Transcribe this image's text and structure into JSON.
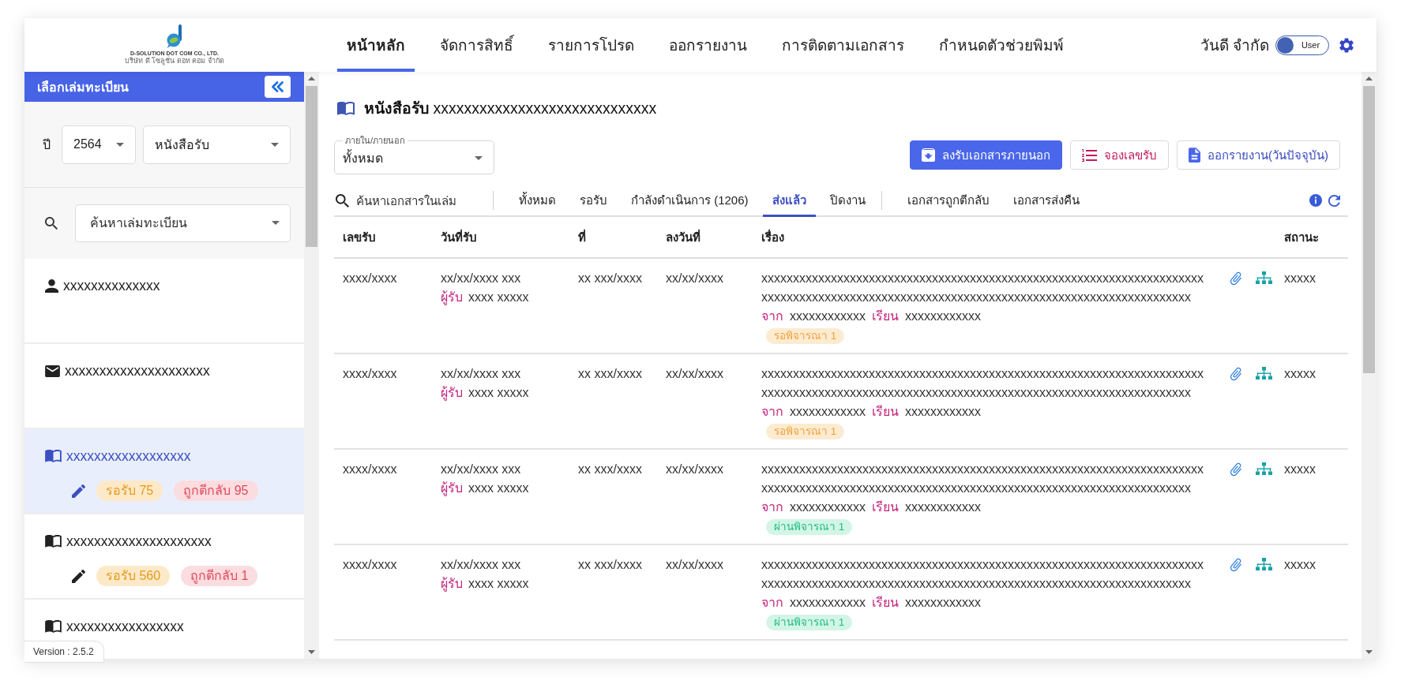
{
  "header": {
    "logo": {
      "company": "D-SOLUTION DOT COM CO., LTD.",
      "company_thai": "บริษัท ดี โซลูชั่น ดอท คอม จำกัด"
    },
    "nav": [
      {
        "label": "หน้าหลัก",
        "selected": true
      },
      {
        "label": "จัดการสิทธิ์",
        "selected": false
      },
      {
        "label": "รายการโปรด",
        "selected": false
      },
      {
        "label": "ออกรายงาน",
        "selected": false
      },
      {
        "label": "การติดตามเอกสาร",
        "selected": false
      },
      {
        "label": "กำหนดตัวช่วยพิมพ์",
        "selected": false
      }
    ],
    "user_name": "วันดี จำกัด",
    "role_toggle": {
      "label": "User",
      "on": false
    }
  },
  "sidebar": {
    "title": "เลือกเล่มทะเบียน",
    "year_label": "ปี",
    "year_select": {
      "value": "2564"
    },
    "type_select": {
      "value": "หนังสือรับ"
    },
    "book_search": {
      "placeholder": "ค้นหาเล่มทะเบียน"
    },
    "items": [
      {
        "kind": "person",
        "name": "xxxxxxxxxxxxxx",
        "selected": false
      },
      {
        "kind": "mail",
        "name": "xxxxxxxxxxxxxxxxxxxxx",
        "selected": false
      },
      {
        "kind": "book",
        "name": "xxxxxxxxxxxxxxxxxx",
        "selected": true,
        "badges": [
          {
            "kind": "waiting",
            "label": "รอรับ 75"
          },
          {
            "kind": "returned",
            "label": "ถูกตีกลับ 95"
          }
        ]
      },
      {
        "kind": "book",
        "name": "xxxxxxxxxxxxxxxxxxxxx",
        "selected": false,
        "badges": [
          {
            "kind": "waiting",
            "label": "รอรับ 560"
          },
          {
            "kind": "returned",
            "label": "ถูกตีกลับ 1"
          }
        ]
      },
      {
        "kind": "book",
        "name": "xxxxxxxxxxxxxxxxx",
        "selected": false
      }
    ],
    "version": "Version : 2.5.2"
  },
  "main": {
    "title": "**หนังสือรับ** xxxxxxxxxxxxxxxxxxxxxxxxxxxxx",
    "scope_select": {
      "label": "ภายใน/ภายนอก",
      "value": "ทั้งหมด"
    },
    "buttons": [
      {
        "kind": "register",
        "label": "ลงรับเอกสารภายนอก"
      },
      {
        "kind": "reserve",
        "label": "จองเลขรับ"
      },
      {
        "kind": "report",
        "label": "ออกรายงาน(วันปัจจุบัน)"
      }
    ],
    "doc_search": {
      "placeholder": "ค้นหาเอกสารในเล่ม"
    },
    "status_tabs": [
      {
        "label": "ทั้งหมด",
        "selected": false
      },
      {
        "label": "รอรับ",
        "selected": false
      },
      {
        "label": "กำลังดำเนินการ (1206)",
        "selected": false
      },
      {
        "label": "ส่งแล้ว",
        "selected": true
      },
      {
        "label": "ปิดงาน",
        "selected": false
      }
    ],
    "return_tabs": [
      {
        "label": "เอกสารถูกตีกลับ",
        "selected": false
      },
      {
        "label": "เอกสารส่งคืน",
        "selected": false
      }
    ],
    "table": {
      "columns": [
        "เลขรับ",
        "วันที่รับ",
        "ที่",
        "ลงวันที่",
        "เรื่อง",
        "สถานะ"
      ],
      "rows": [
        {
          "number": "xxxx/xxxx",
          "received": "xx/xx/xxxx xxx",
          "receiver_label": "ผู้รับ",
          "receiver": "xxxx xxxxx",
          "ref": "xx xxx/xxxx",
          "dated": "xx/xx/xxxx",
          "subject": "xxxxxxxxxxxxxxxxxxxxxxxxxxxxxxxxxxxxxxxxxxxxxxxxxxxxxxxxxxxxxxxxxxxxxxxxxxxxxxxxxxxxxxxxxxxxxxxxxxxxxxxxxxxxxxxxxxxxxxxxxxxxxxxxxxxxxxxxxx",
          "from_label": "จาก",
          "from": "xxxxxxxxxxxx",
          "to_label": "เรียน",
          "to": "xxxxxxxxxxxx",
          "review": {
            "kind": "pending",
            "label": "รอพิจารณา 1"
          },
          "status": "xxxxx"
        },
        {
          "number": "xxxx/xxxx",
          "received": "xx/xx/xxxx xxx",
          "receiver_label": "ผู้รับ",
          "receiver": "xxxx xxxxx",
          "ref": "xx xxx/xxxx",
          "dated": "xx/xx/xxxx",
          "subject": "xxxxxxxxxxxxxxxxxxxxxxxxxxxxxxxxxxxxxxxxxxxxxxxxxxxxxxxxxxxxxxxxxxxxxxxxxxxxxxxxxxxxxxxxxxxxxxxxxxxxxxxxxxxxxxxxxxxxxxxxxxxxxxxxxxxxxxxxxx",
          "from_label": "จาก",
          "from": "xxxxxxxxxxxx",
          "to_label": "เรียน",
          "to": "xxxxxxxxxxxx",
          "review": {
            "kind": "pending",
            "label": "รอพิจารณา 1"
          },
          "status": "xxxxx"
        },
        {
          "number": "xxxx/xxxx",
          "received": "xx/xx/xxxx xxx",
          "receiver_label": "ผู้รับ",
          "receiver": "xxxx xxxxx",
          "ref": "xx xxx/xxxx",
          "dated": "xx/xx/xxxx",
          "subject": "xxxxxxxxxxxxxxxxxxxxxxxxxxxxxxxxxxxxxxxxxxxxxxxxxxxxxxxxxxxxxxxxxxxxxxxxxxxxxxxxxxxxxxxxxxxxxxxxxxxxxxxxxxxxxxxxxxxxxxxxxxxxxxxxxxxxxxxxxx",
          "from_label": "จาก",
          "from": "xxxxxxxxxxxx",
          "to_label": "เรียน",
          "to": "xxxxxxxxxxxx",
          "review": {
            "kind": "approved",
            "label": "ผ่านพิจารณา 1"
          },
          "status": "xxxxx"
        },
        {
          "number": "xxxx/xxxx",
          "received": "xx/xx/xxxx xxx",
          "receiver_label": "ผู้รับ",
          "receiver": "xxxx xxxxx",
          "ref": "xx xxx/xxxx",
          "dated": "xx/xx/xxxx",
          "subject": "xxxxxxxxxxxxxxxxxxxxxxxxxxxxxxxxxxxxxxxxxxxxxxxxxxxxxxxxxxxxxxxxxxxxxxxxxxxxxxxxxxxxxxxxxxxxxxxxxxxxxxxxxxxxxxxxxxxxxxxxxxxxxxxxxxxxxxxxxx",
          "from_label": "จาก",
          "from": "xxxxxxxxxxxx",
          "to_label": "เรียน",
          "to": "xxxxxxxxxxxx",
          "review": {
            "kind": "approved",
            "label": "ผ่านพิจารณา 1"
          },
          "status": "xxxxx"
        }
      ]
    }
  }
}
